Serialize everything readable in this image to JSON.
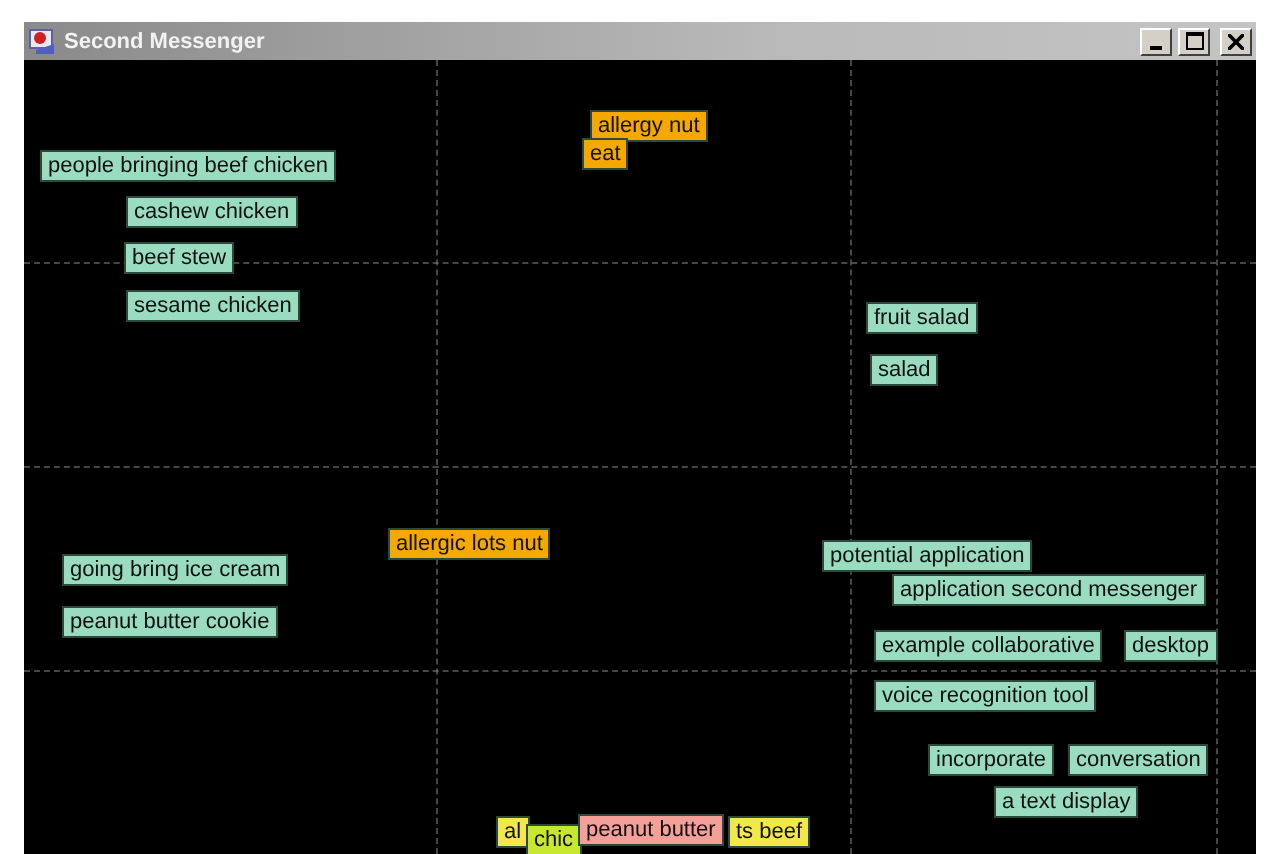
{
  "window": {
    "title": "Second Messenger"
  },
  "tags": [
    {
      "text": "allergy nut",
      "color": "#f5a800"
    },
    {
      "text": "eat",
      "color": "#f5a800"
    },
    {
      "text": "people bringing beef chicken",
      "color": "#99dcc0"
    },
    {
      "text": "cashew chicken",
      "color": "#99dcc0"
    },
    {
      "text": "beef stew",
      "color": "#99dcc0"
    },
    {
      "text": "sesame chicken",
      "color": "#99dcc0"
    },
    {
      "text": "fruit salad",
      "color": "#99dcc0"
    },
    {
      "text": "salad",
      "color": "#99dcc0"
    },
    {
      "text": "allergic lots nut",
      "color": "#f5a800"
    },
    {
      "text": "going bring ice cream",
      "color": "#99dcc0"
    },
    {
      "text": "potential application",
      "color": "#99dcc0"
    },
    {
      "text": "application second messenger",
      "color": "#99dcc0"
    },
    {
      "text": "peanut butter cookie",
      "color": "#99dcc0"
    },
    {
      "text": "example collaborative",
      "color": "#99dcc0"
    },
    {
      "text": "desktop",
      "color": "#99dcc0"
    },
    {
      "text": "voice recognition tool",
      "color": "#99dcc0"
    },
    {
      "text": "incorporate",
      "color": "#99dcc0"
    },
    {
      "text": "conversation",
      "color": "#99dcc0"
    },
    {
      "text": "a text display",
      "color": "#99dcc0"
    },
    {
      "text": "al",
      "color": "#f3e84a"
    },
    {
      "text": "ts beef",
      "color": "#f3e84a"
    },
    {
      "text": "chic",
      "color": "#c8e830"
    },
    {
      "text": "peanut butter",
      "color": "#f4a098"
    }
  ]
}
